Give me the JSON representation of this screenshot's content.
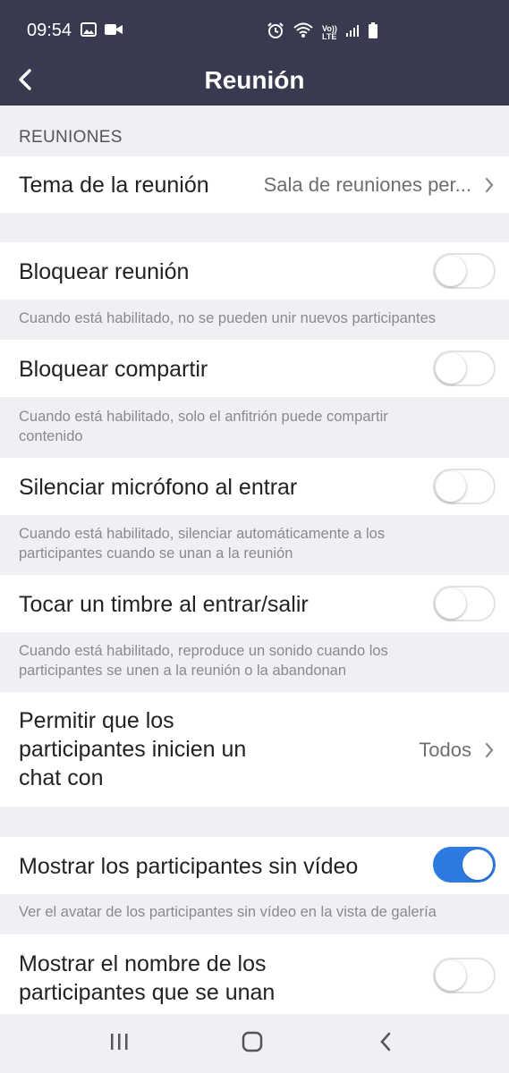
{
  "status_bar": {
    "time": "09:54",
    "icons_left": [
      "image-icon",
      "video-camera-icon"
    ],
    "icons_right": [
      "alarm-icon",
      "wifi-icon",
      "volte-icon",
      "signal-icon",
      "battery-icon"
    ],
    "volte_top": "Vo))",
    "volte_bottom": "LTE"
  },
  "header": {
    "title": "Reunión",
    "back_icon": "chevron-left-icon"
  },
  "section": {
    "title": "REUNIONES"
  },
  "meeting_topic": {
    "label": "Tema de la reunión",
    "value": "Sala de reuniones per..."
  },
  "settings": [
    {
      "label": "Bloquear reunión",
      "enabled": false,
      "description": "Cuando está habilitado, no se pueden unir nuevos participantes"
    },
    {
      "label": "Bloquear compartir",
      "enabled": false,
      "description_line1": "Cuando está habilitado, solo el anfitrión puede compartir",
      "description_line2": "contenido"
    },
    {
      "label": "Silenciar micrófono al entrar",
      "enabled": false,
      "description_line1": "Cuando está habilitado, silenciar automáticamente a los",
      "description_line2": "participantes cuando se unan a la reunión"
    },
    {
      "label": "Tocar un timbre al entrar/salir",
      "enabled": false,
      "description_line1": "Cuando está habilitado, reproduce un sonido cuando los",
      "description_line2": "participantes se unen a la reunión o la abandonan"
    }
  ],
  "chat_permission": {
    "label_line1": "Permitir que los",
    "label_line2": "participantes inicien un",
    "label_line3": "chat con",
    "value": "Todos"
  },
  "show_no_video": {
    "label": "Mostrar los participantes sin vídeo",
    "enabled": true,
    "description": "Ver el avatar de los participantes sin vídeo en la vista de galería"
  },
  "show_join_names": {
    "label_line1": "Mostrar el nombre de los",
    "label_line2": "participantes que se unan",
    "enabled": false
  },
  "system_nav": {
    "buttons": [
      "recent-apps-icon",
      "home-icon",
      "back-icon"
    ]
  },
  "colors": {
    "header_bg": "#393a4f",
    "toggle_on": "#2d7ae0",
    "page_bg": "#efeff4"
  }
}
